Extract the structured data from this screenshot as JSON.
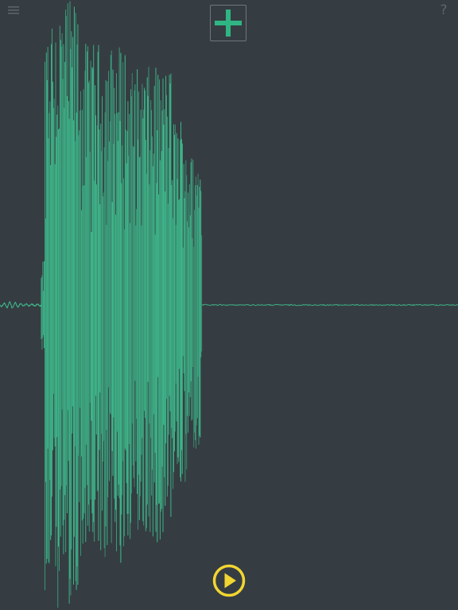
{
  "app": {
    "background": "#353d42",
    "waveform_color": "#3fbf8f",
    "toolbar_icon_color": "#5d666b",
    "accent_add_color": "#2fb582",
    "accent_play_color": "#f2d631"
  },
  "toolbar": {
    "menu_icon": "hamburger-menu-icon",
    "add_icon": "plus-icon",
    "help_icon": "question-mark-icon",
    "help_label": "?"
  },
  "player": {
    "play_icon": "play-circle-icon"
  }
}
